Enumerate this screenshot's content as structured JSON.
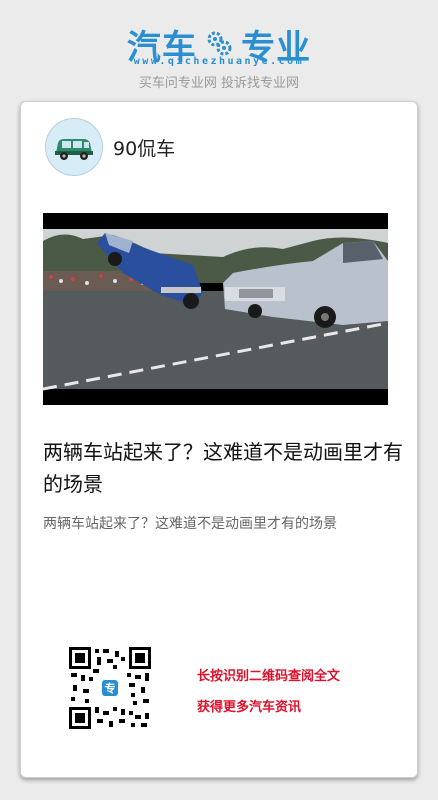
{
  "header": {
    "logo_left": "汽车",
    "logo_right": "专业",
    "domain": "www.qichezhuanye.com",
    "slogan": "买车问专业网 投诉找专业网",
    "brand_color": "#2a8fd0"
  },
  "author": {
    "name": "90侃车",
    "avatar_icon": "car-avatar-icon"
  },
  "video": {
    "thumbnail_icon": "lowrider-cars-image"
  },
  "article": {
    "title": "两辆车站起来了？这难道不是动画里才有的场景",
    "summary": "两辆车站起来了？这难道不是动画里才有的场景"
  },
  "footer": {
    "qr_icon": "qr-code-icon",
    "line1": "长按识别二维码查阅全文",
    "line2": "获得更多汽车资讯",
    "accent_color": "#e0102a"
  }
}
